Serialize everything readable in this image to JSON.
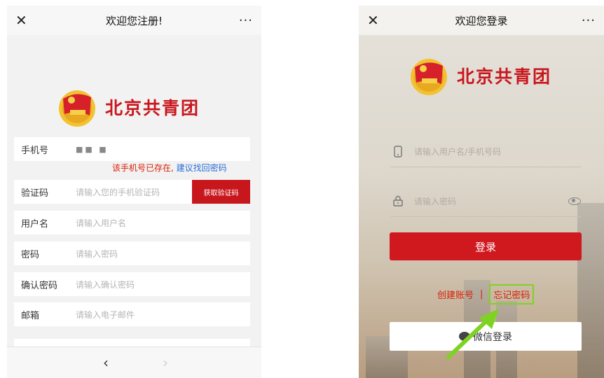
{
  "register": {
    "title": "欢迎您注册!",
    "close_glyph": "✕",
    "more_glyph": "···",
    "logo_text": "北京共青团",
    "phone": {
      "label": "手机号",
      "value": "■■ ■"
    },
    "warning_red": "该手机号已存在,",
    "warning_blue": "建议找回密码",
    "code": {
      "label": "验证码",
      "placeholder": "请输入您的手机验证码",
      "button": "获取验证码"
    },
    "username": {
      "label": "用户名",
      "placeholder": "请输入用户名"
    },
    "password": {
      "label": "密码",
      "placeholder": "请输入密码"
    },
    "confirm": {
      "label": "确认密码",
      "placeholder": "请输入确认密码"
    },
    "email": {
      "label": "邮箱",
      "placeholder": "请输入电子邮件"
    },
    "nav_back": "‹",
    "nav_forward": "›"
  },
  "login": {
    "title": "欢迎您登录",
    "close_glyph": "✕",
    "more_glyph": "···",
    "logo_text": "北京共青团",
    "account_placeholder": "请输入用户名/手机号码",
    "password_placeholder": "请输入密码",
    "login_button": "登录",
    "create_account": "创建账号",
    "separator": "|",
    "forgot_password": "忘记密码",
    "wechat_login": "微信登录"
  },
  "colors": {
    "brand_red": "#c8161d",
    "link_blue": "#2b6ed6",
    "highlight_green": "#7ed321"
  }
}
